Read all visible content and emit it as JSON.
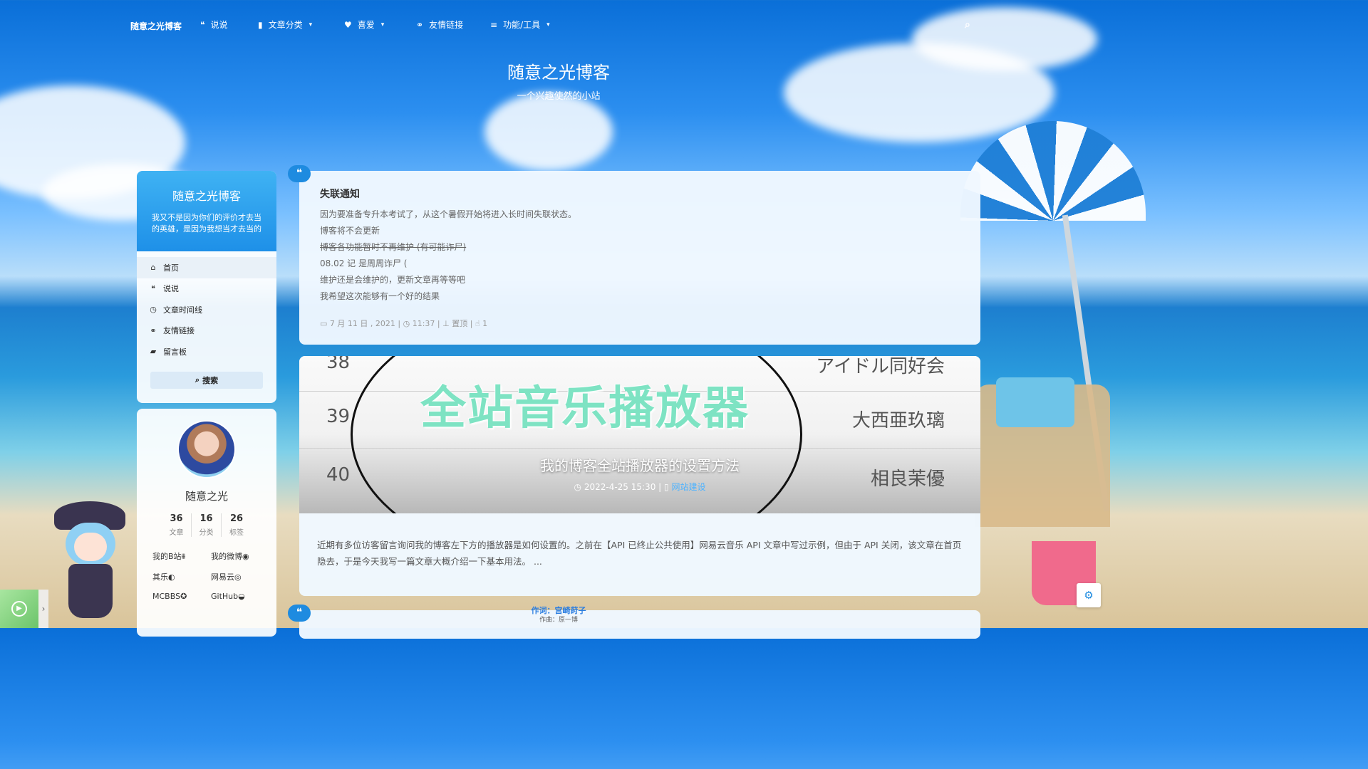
{
  "nav": {
    "brand": "随意之光博客",
    "items": [
      {
        "icon": "quote-icon",
        "glyph": "❝",
        "label": "说说",
        "dropdown": false
      },
      {
        "icon": "bookmark-icon",
        "glyph": "▮",
        "label": "文章分类",
        "dropdown": true
      },
      {
        "icon": "heart-icon",
        "glyph": "♥",
        "label": "喜爱",
        "dropdown": true
      },
      {
        "icon": "link-icon",
        "glyph": "⚭",
        "label": "友情链接",
        "dropdown": false
      },
      {
        "icon": "menu-icon",
        "glyph": "≡",
        "label": "功能/工具",
        "dropdown": true
      }
    ],
    "caret": "▾",
    "search_icon": "search-icon",
    "search_glyph": "⌕"
  },
  "header": {
    "title": "随意之光博客",
    "subtitle": "一个兴趣使然的小站"
  },
  "sidebar": {
    "title": "随意之光博客",
    "description": "我又不是因为你们的评价才去当的英雄，是因为我想当才去当的",
    "menu": [
      {
        "icon": "home-icon",
        "glyph": "⌂",
        "label": "首页",
        "active": true
      },
      {
        "icon": "quote-icon",
        "glyph": "❝",
        "label": "说说",
        "active": false
      },
      {
        "icon": "clock-icon",
        "glyph": "◷",
        "label": "文章时间线",
        "active": false
      },
      {
        "icon": "link-icon",
        "glyph": "⚭",
        "label": "友情链接",
        "active": false
      },
      {
        "icon": "comments-icon",
        "glyph": "▰",
        "label": "留言板",
        "active": false
      }
    ],
    "search_label": "搜索",
    "search_glyph": "⌕"
  },
  "profile": {
    "name": "随意之光",
    "stats": [
      {
        "value": "36",
        "label": "文章"
      },
      {
        "value": "16",
        "label": "分类"
      },
      {
        "value": "26",
        "label": "标签"
      }
    ],
    "links": [
      {
        "label": "我的B站",
        "icon": "bilibili-icon",
        "glyph": "⩩"
      },
      {
        "label": "我的微博",
        "icon": "weibo-icon",
        "glyph": "◉"
      },
      {
        "label": "其乐",
        "icon": "keylol-icon",
        "glyph": "◐"
      },
      {
        "label": "网易云",
        "icon": "netease-music-icon",
        "glyph": "◎"
      },
      {
        "label": "MCBBS",
        "icon": "mcbbs-icon",
        "glyph": "✪"
      },
      {
        "label": "GitHub",
        "icon": "github-icon",
        "glyph": "◒"
      }
    ]
  },
  "post1": {
    "badge": "❝",
    "title": "失联通知",
    "lines": [
      {
        "text": "因为要准备专升本考试了，从这个暑假开始将进入长时间失联状态。",
        "strike": false
      },
      {
        "text": "博客将不会更新",
        "strike": false
      },
      {
        "text": "博客各功能暂时不再维护 (有可能诈尸)",
        "strike": true
      },
      {
        "text": "08.02 记 是周周诈尸 (",
        "strike": false
      },
      {
        "text": "维护还是会维护的，更新文章再等等吧",
        "strike": false
      },
      {
        "text": "我希望这次能够有一个好的结果",
        "strike": false
      }
    ],
    "meta": {
      "date": "7 月 11 日 , 2021",
      "time": "11:37",
      "pinned": "置顶",
      "likes": "1"
    }
  },
  "post2": {
    "image_text": "全站音乐播放器",
    "rows": [
      {
        "num": "38",
        "name": "アイドル同好会"
      },
      {
        "num": "39",
        "name": "大西亜玖璃"
      },
      {
        "num": "40",
        "name": "相良茉優"
      }
    ],
    "title": "我的博客全站播放器的设置方法",
    "datetime": "2022-4-25 15:30",
    "category": "网站建设",
    "excerpt": "近期有多位访客留言询问我的博客左下方的播放器是如何设置的。之前在【API 已终止公共使用】网易云音乐 API 文章中写过示例，但由于 API 关闭，该文章在首页隐去，于是今天我写一篇文章大概介绍一下基本用法。 ..."
  },
  "post3": {
    "badge": "❝"
  },
  "lyrics": {
    "line1": "作词：宫崎莳子",
    "line2": "作曲：原一博"
  },
  "player": {
    "play_glyph": "▶",
    "arrow_glyph": "›"
  },
  "settings_glyph": "⚙"
}
